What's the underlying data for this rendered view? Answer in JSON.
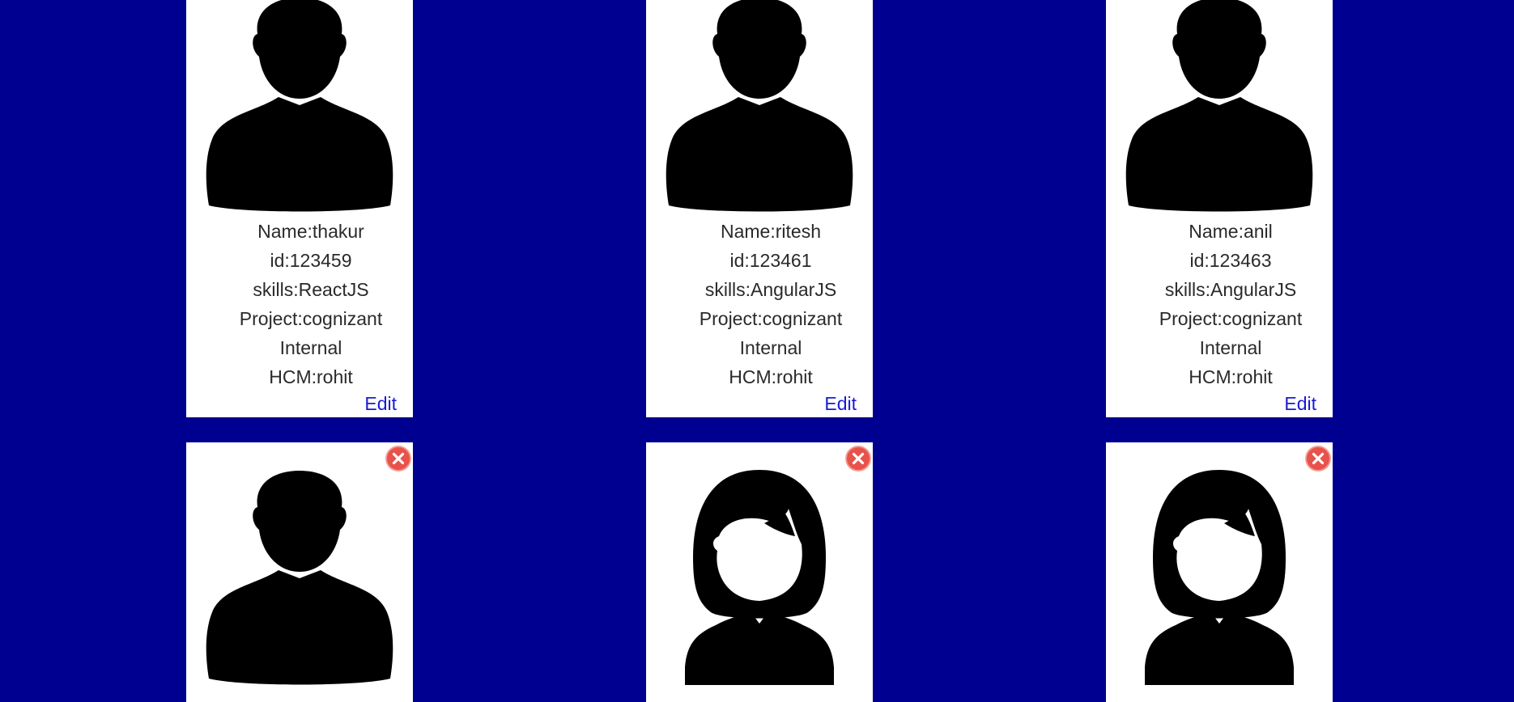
{
  "cards_top": [
    {
      "name_line": "Name:thakur",
      "id_line": "id:123459",
      "skills_line": "skills:ReactJS",
      "project_line": "Project:cognizant",
      "project_line2": "Internal",
      "hcm_line": "HCM:rohit",
      "edit_label": "Edit",
      "avatar_icon": "male-avatar-icon"
    },
    {
      "name_line": "Name:ritesh",
      "id_line": "id:123461",
      "skills_line": "skills:AngularJS",
      "project_line": "Project:cognizant",
      "project_line2": "Internal",
      "hcm_line": "HCM:rohit",
      "edit_label": "Edit",
      "avatar_icon": "male-avatar-icon"
    },
    {
      "name_line": "Name:anil",
      "id_line": "id:123463",
      "skills_line": "skills:AngularJS",
      "project_line": "Project:cognizant",
      "project_line2": "Internal",
      "hcm_line": "HCM:rohit",
      "edit_label": "Edit",
      "avatar_icon": "male-avatar-icon"
    }
  ],
  "cards_bottom": [
    {
      "avatar_icon": "male-avatar-icon",
      "close_icon": "close-icon"
    },
    {
      "avatar_icon": "female-avatar-icon",
      "close_icon": "close-icon"
    },
    {
      "avatar_icon": "female-avatar-icon",
      "close_icon": "close-icon"
    }
  ],
  "colors": {
    "background": "#000090",
    "card": "#ffffff",
    "text": "#2a2a2a",
    "link": "#1a1ad6",
    "close_button": "#e8524a"
  }
}
